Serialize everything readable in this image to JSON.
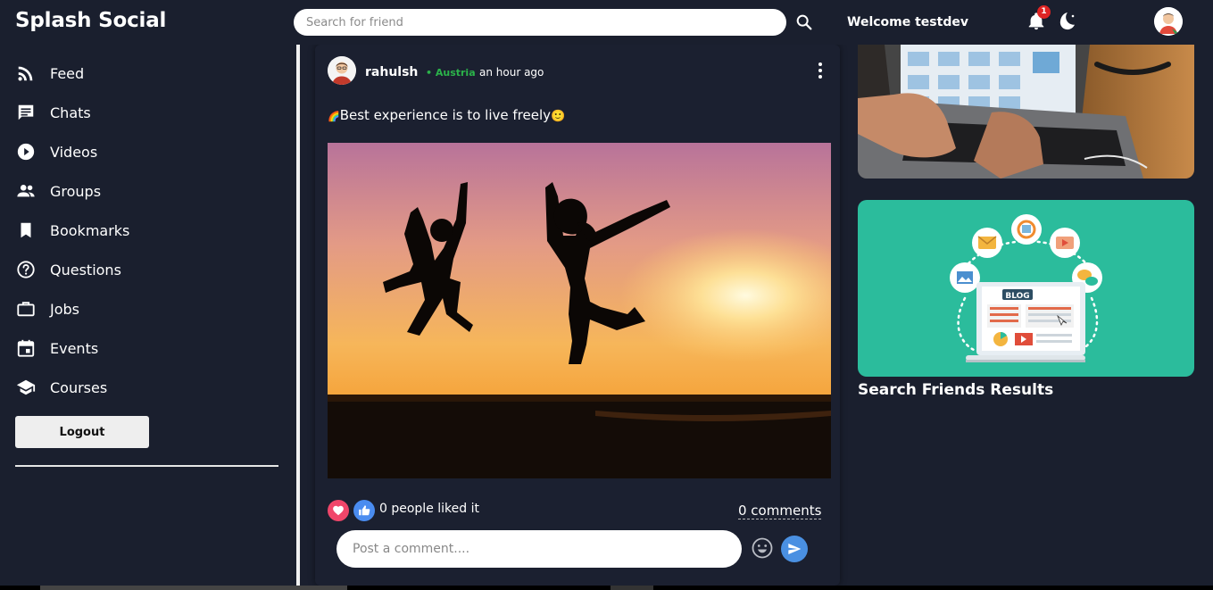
{
  "header": {
    "brand": "Splash Social",
    "search_placeholder": "Search for friend",
    "search_icon": "search-icon",
    "welcome": "Welcome testdev",
    "notification_count": "1",
    "notification_icon": "bell-icon",
    "theme_icon": "dark-mode-toggle-icon",
    "avatar_icon": "user-avatar"
  },
  "sidebar": {
    "items": [
      {
        "label": "Feed",
        "icon": "rss-feed-icon"
      },
      {
        "label": "Chats",
        "icon": "chat-icon"
      },
      {
        "label": "Videos",
        "icon": "play-circle-icon"
      },
      {
        "label": "Groups",
        "icon": "group-icon"
      },
      {
        "label": "Bookmarks",
        "icon": "bookmark-icon"
      },
      {
        "label": "Questions",
        "icon": "help-circle-icon"
      },
      {
        "label": "Jobs",
        "icon": "briefcase-icon"
      },
      {
        "label": "Events",
        "icon": "calendar-icon"
      },
      {
        "label": "Courses",
        "icon": "school-icon"
      }
    ],
    "logout": "Logout"
  },
  "post": {
    "username": "rahulsh",
    "location": "• Austria",
    "time": "an hour ago",
    "text": "Best experience is to live freely",
    "likes": "0 people liked it",
    "comments": "0 comments",
    "comment_placeholder": "Post a comment...."
  },
  "right": {
    "heading": "Search Friends Results",
    "blog_sign": "BLOG"
  },
  "colors": {
    "background": "#1a1f2e",
    "location": "#2bb34a",
    "heart": "#f0466a",
    "like": "#4a8cf0",
    "send": "#4a90e2",
    "badge": "#e02424",
    "blog_bg": "#2bbc9c"
  }
}
